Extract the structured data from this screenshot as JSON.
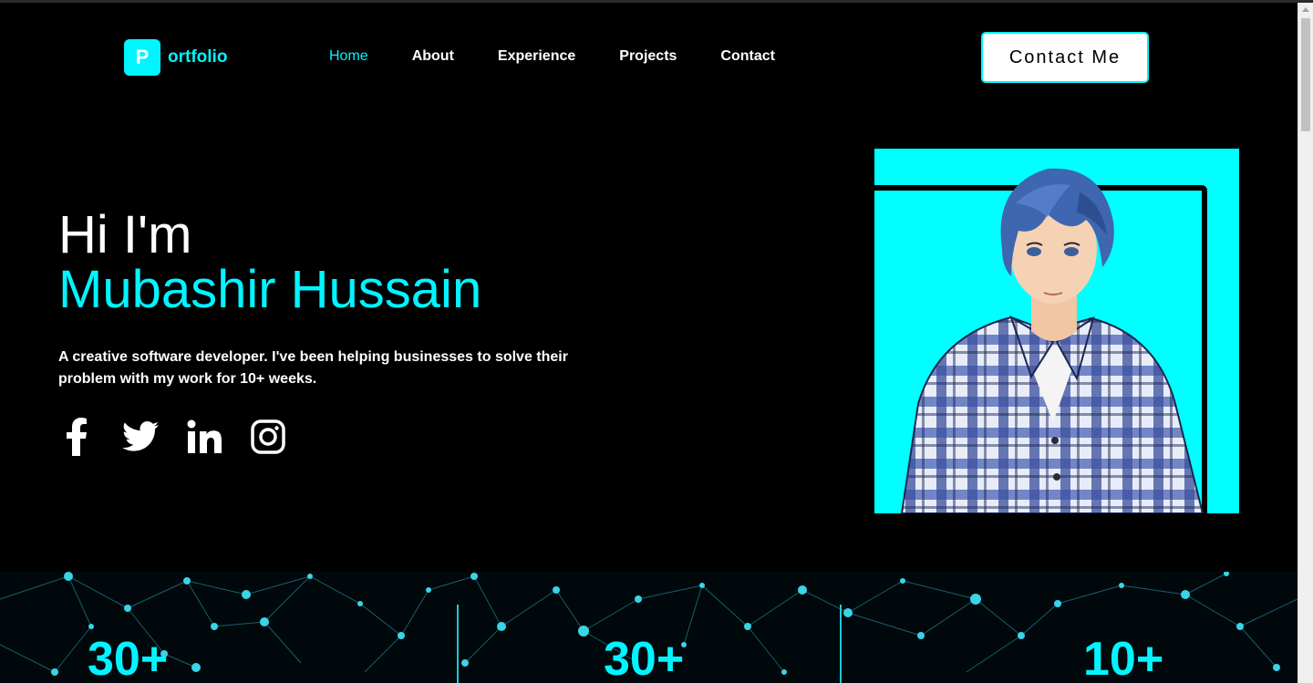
{
  "brand": {
    "badge": "P",
    "text": "ortfolio"
  },
  "nav": {
    "items": [
      {
        "label": "Home",
        "active": true
      },
      {
        "label": "About",
        "active": false
      },
      {
        "label": "Experience",
        "active": false
      },
      {
        "label": "Projects",
        "active": false
      },
      {
        "label": "Contact",
        "active": false
      }
    ]
  },
  "header": {
    "cta_label": "Contact Me"
  },
  "hero": {
    "greeting": "Hi I'm",
    "name": "Mubashir Hussain",
    "description": "A creative software developer. I've been helping businesses to solve their problem with my work for 10+ weeks."
  },
  "socials": [
    "facebook-icon",
    "twitter-icon",
    "linkedin-icon",
    "instagram-icon"
  ],
  "stats": {
    "values": [
      "30+",
      "30+",
      "10+"
    ]
  },
  "colors": {
    "accent": "#00f5ff",
    "background": "#000000",
    "text": "#ffffff"
  }
}
